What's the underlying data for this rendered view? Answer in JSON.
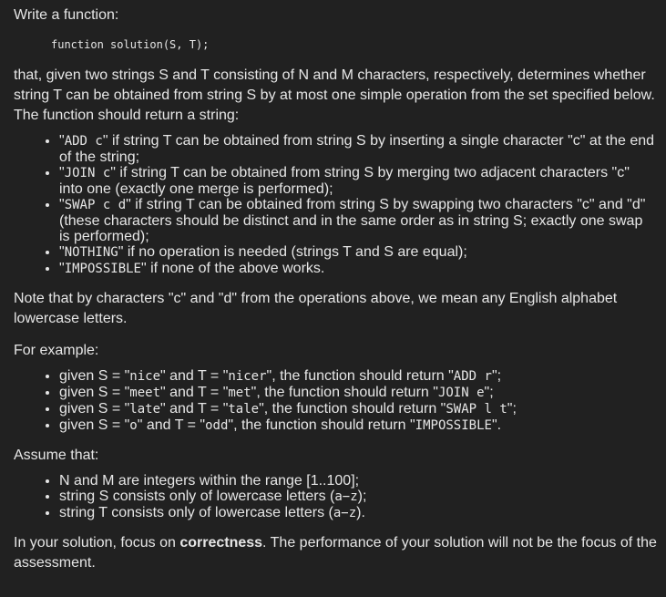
{
  "intro": "Write a function:",
  "code": "function solution(S, T);",
  "desc": "that, given two strings S and T consisting of N and M characters, respectively, determines whether string T can be obtained from string S by at most one simple operation from the set specified below. The function should return a string:",
  "ops": [
    {
      "p1": "\"",
      "c": "ADD c",
      "p2": "\" if string T can be obtained from string S by inserting a single character \"c\" at the end of the string;"
    },
    {
      "p1": "\"",
      "c": "JOIN c",
      "p2": "\" if string T can be obtained from string S by merging two adjacent characters \"c\" into one (exactly one merge is performed);"
    },
    {
      "p1": "\"",
      "c": "SWAP c d",
      "p2": "\" if string T can be obtained from string S by swapping two characters \"c\" and \"d\" (these characters should be distinct and in the same order as in string S; exactly one swap is performed);"
    },
    {
      "p1": "\"",
      "c": "NOTHING",
      "p2": "\" if no operation is needed (strings T and S are equal);"
    },
    {
      "p1": "\"",
      "c": "IMPOSSIBLE",
      "p2": "\" if none of the above works."
    }
  ],
  "note": "Note that by characters \"c\" and \"d\" from the operations above, we mean any English alphabet lowercase letters.",
  "example_header": "For example:",
  "examples": [
    {
      "a": "given S = \"",
      "s": "nice",
      "b": "\" and T = \"",
      "t": "nicer",
      "c": "\", the function should return \"",
      "r": "ADD r",
      "d": "\";"
    },
    {
      "a": "given S = \"",
      "s": "meet",
      "b": "\" and T = \"",
      "t": "met",
      "c": "\", the function should return \"",
      "r": "JOIN e",
      "d": "\";"
    },
    {
      "a": "given S = \"",
      "s": "late",
      "b": "\" and T = \"",
      "t": "tale",
      "c": "\", the function should return \"",
      "r": "SWAP l t",
      "d": "\";"
    },
    {
      "a": "given S = \"",
      "s": "o",
      "b": "\" and T = \"",
      "t": "odd",
      "c": "\", the function should return \"",
      "r": "IMPOSSIBLE",
      "d": "\"."
    }
  ],
  "assume_header": "Assume that:",
  "assumptions": [
    {
      "a": "N and M are integers within the range [1..100];",
      "m": "",
      "z": ""
    },
    {
      "a": "string S consists only of lowercase letters (",
      "m": "a−z",
      "z": ");"
    },
    {
      "a": "string T consists only of lowercase letters (",
      "m": "a−z",
      "z": ")."
    }
  ],
  "final_a": "In your solution, focus on ",
  "final_bold": "correctness",
  "final_b": ". The performance of your solution will not be the focus of the assessment."
}
